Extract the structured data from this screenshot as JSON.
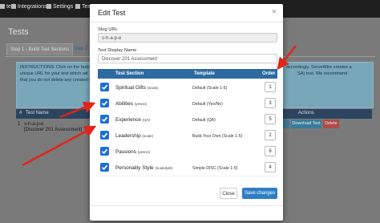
{
  "topbar": {
    "items": [
      {
        "label": "ted",
        "icon": "users-icon"
      },
      {
        "label": "Integrations",
        "icon": "plug-icon"
      },
      {
        "label": "Settings",
        "icon": "gear-icon"
      },
      {
        "label": "Tests",
        "icon": "list-icon"
      }
    ]
  },
  "page": {
    "title": "Tests",
    "tabs": [
      "Step 1 - Build Test Sections",
      "Step 2 - C"
    ],
    "instructions": {
      "left": [
        "INSTRUCTIONS: Click on the butto",
        "unique URL for your test which wil",
        "that you do not delete any created test f"
      ],
      "right": [
        "accordingly. ServeWire creates a",
        "SA) test. We recommend"
      ]
    },
    "table": {
      "headers": [
        "#",
        "Test Name",
        "Actions"
      ],
      "row": {
        "num": "1",
        "slug": "s-h-a-p-e",
        "name": "[Discover 201 Assessment]"
      },
      "row_buttons": [
        "",
        "Download Test",
        "Delete"
      ]
    }
  },
  "modal": {
    "title": "Edit Test",
    "close_symbol": "×",
    "slug_label": "Slug URL",
    "slug_value": "s-h-a-p-e",
    "display_label": "Test Display Name",
    "display_value": "Discover 201 Assessment",
    "columns": {
      "section": "Test Section",
      "template": "Template",
      "order": "Order"
    },
    "rows": [
      {
        "name": "Spiritual Gifts",
        "sub": "(scale)",
        "template": "Default (Scale 1-5)",
        "order": "1"
      },
      {
        "name": "Abilities",
        "sub": "(yesno)",
        "template": "Default (Yes/No)",
        "order": "3"
      },
      {
        "name": "Experience",
        "sub": "(QA)",
        "template": "Default (QA)",
        "order": "5"
      },
      {
        "name": "Leadership",
        "sub": "(scale)",
        "template": "Build Your Own (Scale 1-5)",
        "order": "2"
      },
      {
        "name": "Passions",
        "sub": "(yesno)",
        "template": "",
        "order": "6"
      },
      {
        "name": "Personality Style",
        "sub": "(scaledyle)",
        "template": "Simple DISC (Scale 1-5)",
        "order": "4"
      }
    ],
    "checkbox_checked": true,
    "buttons": {
      "close": "Close",
      "save": "Save changes"
    }
  },
  "colors": {
    "header": "#2d6aa0",
    "checkbox": "#1c6fd1",
    "save": "#2f7ec4",
    "arrow": "#e0251b"
  }
}
